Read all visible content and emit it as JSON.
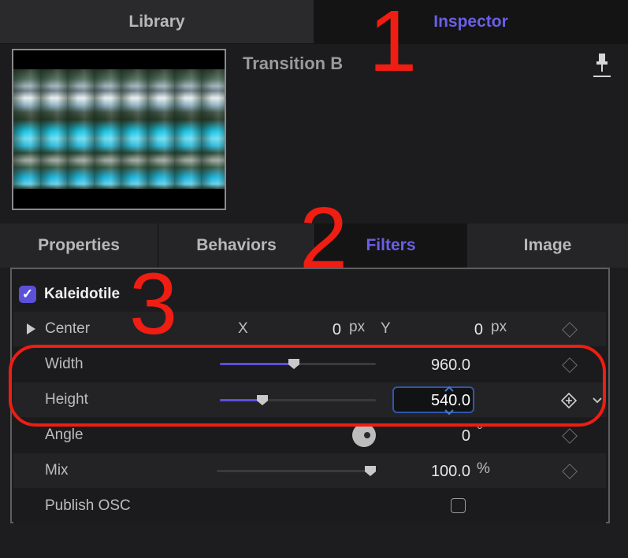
{
  "top_tabs": {
    "library": "Library",
    "inspector": "Inspector"
  },
  "header": {
    "title": "Transition B",
    "pin_icon": "pin-icon"
  },
  "section_tabs": [
    "Properties",
    "Behaviors",
    "Filters",
    "Image"
  ],
  "filter": {
    "name": "Kaleidotile",
    "enabled": true,
    "rows": {
      "center": {
        "label": "Center",
        "x_label": "X",
        "x_value": "0",
        "x_unit": "px",
        "y_label": "Y",
        "y_value": "0",
        "y_unit": "px"
      },
      "width": {
        "label": "Width",
        "value": "960.0",
        "slider_fraction": 0.47
      },
      "height": {
        "label": "Height",
        "value": "540.0",
        "slider_fraction": 0.27
      },
      "angle": {
        "label": "Angle",
        "value": "0",
        "unit": "°"
      },
      "mix": {
        "label": "Mix",
        "value": "100.0",
        "unit": "%",
        "slider_fraction": 1.0
      },
      "publish_osc": {
        "label": "Publish OSC",
        "checked": false
      }
    }
  },
  "annotations": {
    "one": "1",
    "two": "2",
    "three": "3"
  },
  "colors": {
    "accent": "#5b50d9",
    "annotation_red": "#f01d12",
    "focus_blue": "#2e57a8"
  }
}
